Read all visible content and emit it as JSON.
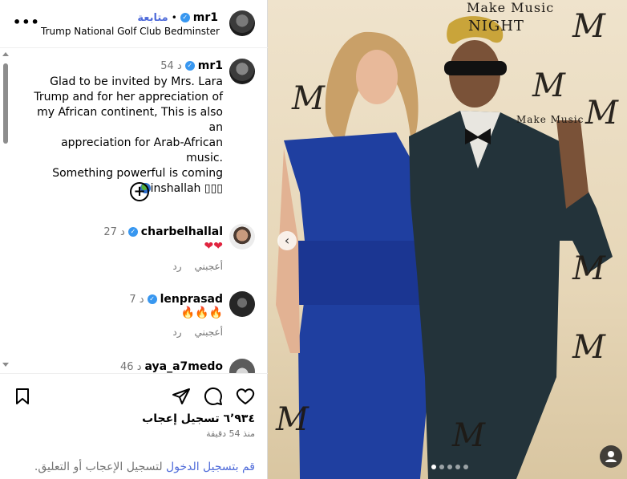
{
  "header": {
    "username": "mr1",
    "follow_label": "متابعة",
    "separator": "•",
    "location": "Trump National Golf Club Bedminster",
    "more_icon": "more-horizontal-icon"
  },
  "caption": {
    "username": "mr1",
    "time": "54 د",
    "lines": [
      "Glad to be invited by Mrs. Lara",
      "Trump and for her appreciation of",
      "my African continent, This is also an",
      "appreciation for Arab-African music.",
      "Something powerful is coming",
      "inshallah"
    ],
    "emoji_tail": "▯▯▯"
  },
  "comments": [
    {
      "username": "charbelhallal",
      "time": "27 د",
      "text": "❤❤",
      "like_label": "أعجبني",
      "reply_label": "رد"
    },
    {
      "username": "lenprasad",
      "time": "7 د",
      "text": "🔥🔥🔥",
      "like_label": "أعجبني",
      "reply_label": "رد"
    },
    {
      "username": "aya_a7medo",
      "time": "46 د",
      "text": "",
      "like_label": "",
      "reply_label": ""
    }
  ],
  "stats": {
    "likes": "٦٬٩٣٤ تسجيل إعجاب",
    "posted": "منذ 54 دقيقة"
  },
  "login_prompt": {
    "link": "قم بتسجيل الدخول",
    "rest": " لتسجيل الإعجاب أو التعليق."
  },
  "photo": {
    "backdrop_brand_top": "Make Music",
    "backdrop_brand_night": "NIGHT",
    "backdrop_brand_small": "Make Music",
    "backdrop_letter": "M",
    "carousel_count": 5,
    "carousel_active": 0
  },
  "colors": {
    "accent_link": "#4f6bd9",
    "verified": "#3897f0",
    "heart": "#e0243f"
  }
}
